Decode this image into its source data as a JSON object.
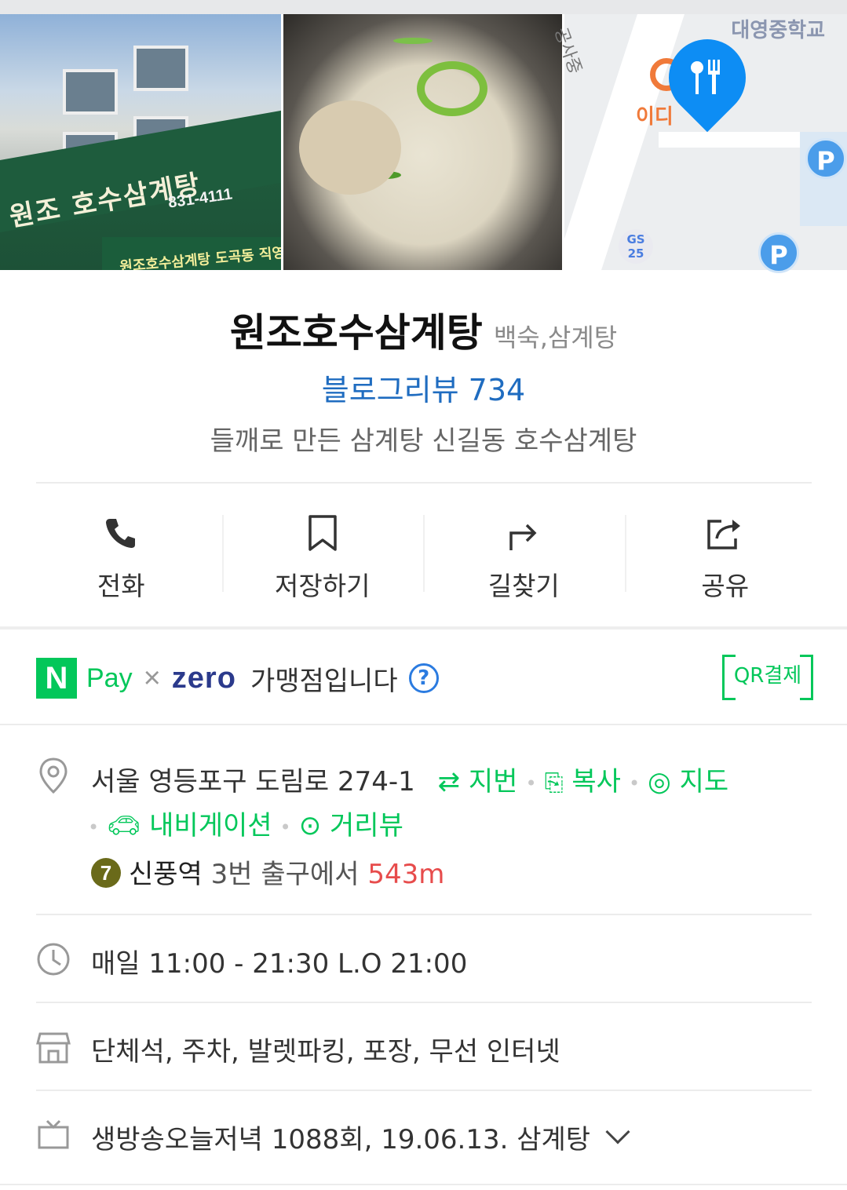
{
  "restaurant": {
    "name": "원조호수삼계탕",
    "category": "백숙,삼계탕",
    "blog_review_label": "블로그리뷰 734",
    "description": "들깨로 만든 삼계탕 신길동 호수삼계탕"
  },
  "gallery": {
    "photo1_sign": "원조 호수삼계탕",
    "photo1_phone": "831-4111",
    "photo1_subsign": "원조호수삼계탕 도곡동 직영점",
    "map_school": "대영중학교",
    "map_shop": "이디",
    "map_street": "공사중",
    "map_parking": "P",
    "map_store": "GS 25"
  },
  "actions": [
    {
      "label": "전화",
      "icon": "phone-icon"
    },
    {
      "label": "저장하기",
      "icon": "bookmark-icon"
    },
    {
      "label": "길찾기",
      "icon": "directions-icon"
    },
    {
      "label": "공유",
      "icon": "share-icon"
    }
  ],
  "pay": {
    "n_logo": "N",
    "pay_word": "Pay",
    "times": "×",
    "zero": "zero",
    "member_text": "가맹점입니다",
    "help": "?",
    "qr_label": "QR결제"
  },
  "address": {
    "text": "서울 영등포구 도림로 274-1",
    "lot_link": "지번",
    "copy_link": "복사",
    "map_link": "지도",
    "nav_link": "내비게이션",
    "street_link": "거리뷰"
  },
  "station": {
    "line": "7",
    "name": "신풍역",
    "exit_text": "3번 출구에서",
    "distance": "543m"
  },
  "hours": "매일 11:00 - 21:30 L.O 21:00",
  "facilities": "단체석, 주차, 발렛파킹, 포장, 무선 인터넷",
  "tv": "생방송오늘저녁 1088회, 19.06.13. 삼계탕",
  "colors": {
    "naver_green": "#03c75a",
    "review_blue": "#1f6cc0",
    "distance_red": "#e74c4c",
    "pin_blue": "#0d8df4"
  }
}
